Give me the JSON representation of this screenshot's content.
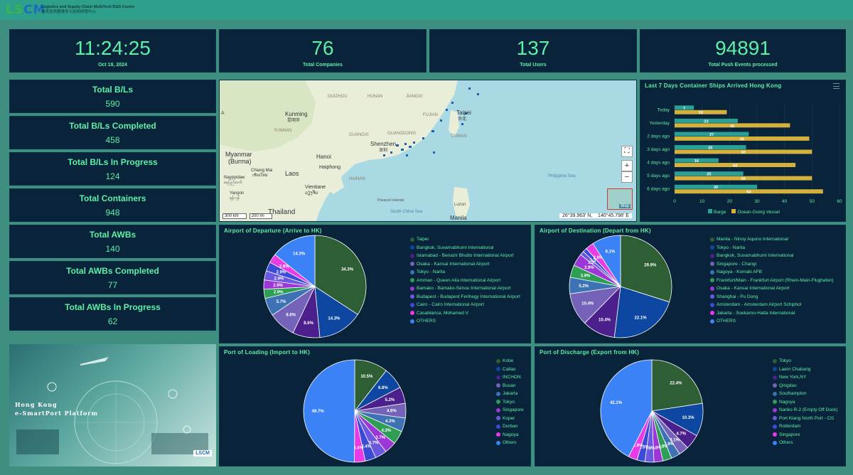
{
  "header": {
    "logo_main": "LS",
    "logo_accent": "CM",
    "org_en": "Logistics and Supply Chain MultiTech R&D Centre",
    "org_zh": "物流及供應鏈多元技術研發中心"
  },
  "top_stats": [
    {
      "value": "11:24:25",
      "label": "Oct 18, 2024"
    },
    {
      "value": "76",
      "label": "Total Companies"
    },
    {
      "value": "137",
      "label": "Total Users"
    },
    {
      "value": "94891",
      "label": "Total Push Events processed"
    }
  ],
  "side_stats": [
    {
      "title": "Total B/Ls",
      "value": "590"
    },
    {
      "title": "Total B/Ls Completed",
      "value": "458"
    },
    {
      "title": "Total B/Ls In Progress",
      "value": "124"
    },
    {
      "title": "Total Containers",
      "value": "948"
    },
    {
      "title": "Total AWBs",
      "value": "140"
    },
    {
      "title": "Total AWBs Completed",
      "value": "77"
    },
    {
      "title": "Total AWBs In Progress",
      "value": "62"
    }
  ],
  "map": {
    "scale_km": "300 km",
    "scale_mi": "200 mi",
    "coords": "26°39.963' N,    140°45.798' E",
    "map_label": "Map",
    "labels": {
      "guizhou": "GUIZHOU",
      "hunan": "HUNAN",
      "jiangxi": "JIANGXI",
      "yunnan": "YUNNAN",
      "guangxi": "GUANGXI",
      "guangdong": "GUANGDONG",
      "fujian": "FUJIAN",
      "taiwan": "TAIWAN",
      "kunming": "Kunming",
      "kunming_zh": "昆明市",
      "taipei": "Taipei",
      "taipei_zh": "台北",
      "shenzhen": "Shenzhen",
      "shenzhen_zh": "深圳",
      "myanmar": "Myanmar",
      "burma": "(Burma)",
      "laos": "Laos",
      "hanoi": "Hanoi",
      "haiphong": "Haiphong",
      "hainan": "HAINAN",
      "vientiane": "Vientiane",
      "vientiane_zh": "ວຽງຈັນ",
      "thailand": "Thailand",
      "manila": "Manila",
      "luzon": "Luzon",
      "philippine_sea": "Philippine Sea",
      "south_china_sea": "South China Sea",
      "paracel": "Paracel Islands",
      "india_edge": "A",
      "chiang_mai": "Chiang Mai",
      "chiang_mai_zh": "เชียงใหม่",
      "naypyidaw": "Naypyidaw",
      "naypyidaw_zh": "နေပြည်တော်",
      "yangon": "Yangon",
      "yangon_zh": "ရန်ကုန်"
    }
  },
  "ships_chart": {
    "title": "Last 7 Days Container Ships Arrived Hong Kong",
    "menu_icon": "hamburger-menu-icon",
    "legend": [
      "Barge",
      "Ocean-Going Vessel"
    ],
    "colors": {
      "barge": "#2aa198",
      "ocean": "#d4b13a"
    },
    "xticks": [
      "0",
      "10",
      "20",
      "30",
      "40",
      "50",
      "60"
    ]
  },
  "pies": {
    "departure": {
      "title": "Airport of Departure (Arrive to HK)"
    },
    "destination": {
      "title": "Airport of Destination (Depart from HK)"
    },
    "loading": {
      "title": "Port of Loading (Import to HK)"
    },
    "discharge": {
      "title": "Port of Discharge (Export from HK)"
    }
  },
  "banner": {
    "line1": "Hong Kong",
    "line2": "e-SmartPort Platform",
    "logo": "LSCM"
  },
  "chart_data": [
    {
      "type": "bar",
      "title": "Last 7 Days Container Ships Arrived Hong Kong",
      "orientation": "horizontal",
      "categories": [
        "Today",
        "Yesterday",
        "2 days ago",
        "3 days ago",
        "4 days ago",
        "5 days ago",
        "6 days ago"
      ],
      "series": [
        {
          "name": "Barge",
          "values": [
            7,
            23,
            27,
            26,
            16,
            25,
            30
          ]
        },
        {
          "name": "Ocean-Going Vessel",
          "values": [
            19,
            42,
            49,
            50,
            44,
            50,
            54
          ]
        }
      ],
      "xlim": [
        0,
        60
      ],
      "legend": "bottom"
    },
    {
      "type": "pie",
      "title": "Airport of Departure (Arrive to HK)",
      "labels": [
        "Taipei",
        "Bangkok, Suvarnabhumi International",
        "Islamabad - Benazir Bhutto International Airport",
        "Osaka - Kansai International Airport",
        "Tokyo - Narita",
        "Amman - Queen Alia International Airport",
        "Bamako - Bamako-Sénou International Airport",
        "Budapest - Budapest Ferihegy International Airport",
        "Cairo - Cairo International Airport",
        "Casablanca, Mohamed V",
        "OTHERS"
      ],
      "values": [
        34.3,
        14.3,
        8.6,
        8.6,
        5.7,
        2.9,
        2.9,
        2.9,
        2.9,
        2.9,
        14.3
      ],
      "colors": [
        "#2e5e34",
        "#0d47a1",
        "#4b1f8c",
        "#7463b8",
        "#3d73b5",
        "#2e9e55",
        "#9d36d6",
        "#6a59e0",
        "#3b4bd8",
        "#e83ae6",
        "#3b82f6"
      ],
      "legend": "right"
    },
    {
      "type": "pie",
      "title": "Airport of Destination (Depart from HK)",
      "labels": [
        "Manila - Ninoy Aquino International",
        "Tokyo - Narita",
        "Bangkok, Suvarnabhumi International",
        "Singapore - Changi",
        "Nagoya - Komaki AFB",
        "Frankfurt/Main - Frankfurt Airport (Rhein-Main-Flughafen)",
        "Osaka - Kansai International Airport",
        "Shanghai - Pu Dong",
        "Amsterdam - Amsterdam Airport Schiphol",
        "Jakarta - Soekarno-Hatta International",
        "OTHERS"
      ],
      "values": [
        29.9,
        22.1,
        10.4,
        10.4,
        5.2,
        3.9,
        3.9,
        1.3,
        1.3,
        2.6,
        9.1
      ],
      "colors": [
        "#2e5e34",
        "#0d47a1",
        "#4b1f8c",
        "#7463b8",
        "#3d73b5",
        "#2e9e55",
        "#9d36d6",
        "#6a59e0",
        "#3b4bd8",
        "#e83ae6",
        "#3b82f6"
      ],
      "legend": "right"
    },
    {
      "type": "pie",
      "title": "Port of Loading (Import to HK)",
      "labels": [
        "Kobe",
        "Callao",
        "INCHON",
        "Busan",
        "Jakarta",
        "Tokyo",
        "Singapore",
        "Koper",
        "Durban",
        "Nagoya",
        "Others"
      ],
      "values": [
        10.5,
        6.8,
        5.2,
        4.6,
        4.3,
        4.3,
        3.7,
        3.7,
        3.4,
        3.4,
        49.7
      ],
      "colors": [
        "#2e5e34",
        "#0d47a1",
        "#4b1f8c",
        "#7463b8",
        "#3d73b5",
        "#2e9e55",
        "#9d36d6",
        "#6a59e0",
        "#3b4bd8",
        "#e83ae6",
        "#3b82f6"
      ],
      "legend": "right"
    },
    {
      "type": "pie",
      "title": "Port of Discharge (Export from HK)",
      "labels": [
        "Tokyo",
        "Laem Chabang",
        "New York,NY",
        "Qingdao",
        "Southampton",
        "Nagoya",
        "Nanko R-2 (Empty Off Dock)",
        "Port Klang North Port - Ct1",
        "Rotterdam",
        "Singapore",
        "Others"
      ],
      "values": [
        22.4,
        10.3,
        4.7,
        3.1,
        2.8,
        2.8,
        2.8,
        2.8,
        2.5,
        2.8,
        42.1
      ],
      "colors": [
        "#2e5e34",
        "#0d47a1",
        "#4b1f8c",
        "#7463b8",
        "#3d73b5",
        "#2e9e55",
        "#9d36d6",
        "#6a59e0",
        "#3b4bd8",
        "#e83ae6",
        "#3b82f6"
      ],
      "legend": "right"
    }
  ]
}
